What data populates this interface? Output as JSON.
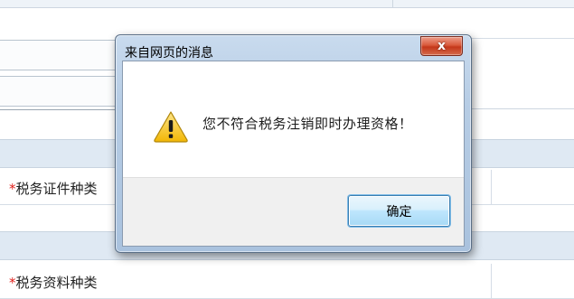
{
  "background_form": {
    "required_mark": "*",
    "rows": [
      {
        "label": "税务证件种类"
      },
      {
        "label": "税务资料种类"
      }
    ]
  },
  "dialog": {
    "title": "来自网页的消息",
    "close_label": "x",
    "icon": "warning-icon",
    "message": "您不符合税务注销即时办理资格！",
    "ok_label": "确定"
  },
  "colors": {
    "dialog_frame": "#b7cde5",
    "close_button": "#c4371a",
    "ok_button": "#bee6fd",
    "warning_yellow": "#f7c623",
    "required_red": "#e0201c",
    "band": "#dfe9f3"
  }
}
